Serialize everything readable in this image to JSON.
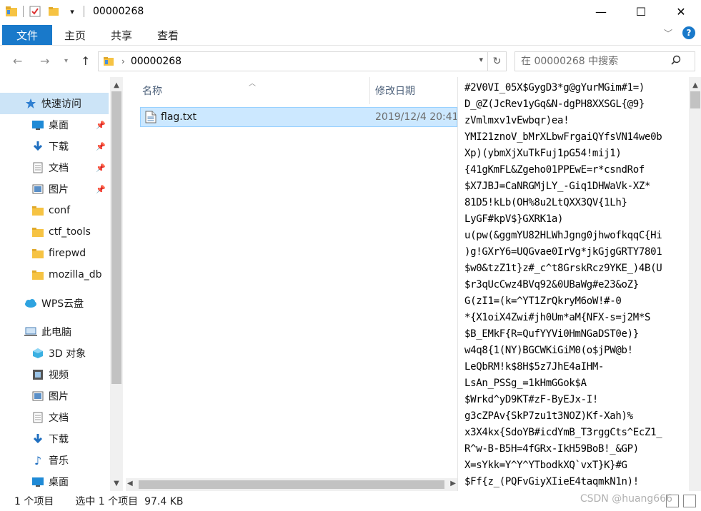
{
  "window": {
    "title": "00000268",
    "controls": {
      "minimize": "—",
      "maximize": "☐",
      "close": "✕"
    }
  },
  "ribbon": {
    "tabs": [
      "文件",
      "主页",
      "共享",
      "查看"
    ]
  },
  "address": {
    "path": "00000268",
    "search_placeholder": "在 00000268 中搜索"
  },
  "nav": {
    "quick_access": "快速访问",
    "items": [
      {
        "label": "桌面",
        "icon": "desktop-icon",
        "pinned": true
      },
      {
        "label": "下载",
        "icon": "download-icon",
        "pinned": true
      },
      {
        "label": "文档",
        "icon": "document-icon",
        "pinned": true
      },
      {
        "label": "图片",
        "icon": "picture-icon",
        "pinned": true
      },
      {
        "label": "conf",
        "icon": "folder-icon",
        "pinned": false
      },
      {
        "label": "ctf_tools",
        "icon": "folder-icon",
        "pinned": false
      },
      {
        "label": "firepwd",
        "icon": "folder-icon",
        "pinned": false
      },
      {
        "label": "mozilla_db",
        "icon": "folder-icon",
        "pinned": false
      }
    ],
    "wps": "WPS云盘",
    "this_pc": "此电脑",
    "pc_items": [
      {
        "label": "3D 对象",
        "icon": "3d-objects-icon"
      },
      {
        "label": "视频",
        "icon": "video-icon"
      },
      {
        "label": "图片",
        "icon": "picture-icon"
      },
      {
        "label": "文档",
        "icon": "document-icon"
      },
      {
        "label": "下载",
        "icon": "download-icon"
      },
      {
        "label": "音乐",
        "icon": "music-icon"
      },
      {
        "label": "桌面",
        "icon": "desktop-icon"
      }
    ]
  },
  "filelist": {
    "col_name": "名称",
    "col_date": "修改日期",
    "files": [
      {
        "name": "flag.txt",
        "date": "2019/12/4 20:41"
      }
    ]
  },
  "preview": {
    "lines": [
      "#2V0VI_05X$GygD3*g@gYurMGim#1=)",
      "D_@Z(JcRev1yGq&N-dgPH8XXSGL{@9}",
      "zVmlmxv1vEwbqr)ea!",
      "YMI21znoV_bMrXLbwFrgaiQYfsVN14we0b",
      "Xp)(ybmXjXuTkFuj1pG54!mij1)",
      "{41gKmFL&Zgeho01PPEwE=r*csndRof",
      "$X7JBJ=CaNRGMjLY_-Giq1DHWaVk-XZ*",
      "81D5!kLb(OH%8u2LtQXX3QV{1Lh}",
      "LyGF#kpV$}GXRK1a)",
      "u(pw(&ggmYU82HLWhJgng0jhwofkqqC{Hi",
      ")g!GXrY6=UQGvae0IrVg*jkGjgGRTY7801",
      "$w0&tzZ1t}z#_c^t8GrskRcz9YKE_)4B(U",
      "$r3qUcCwz4BVq92&0UBaWg#e23&oZ}",
      "G(zI1=(k=^YT1ZrQkryM6oW!#-0",
      "*{X1oiX4Zwi#jh0Um*aM{NFX-s=j2M*S",
      "$B_EMkF{R=QufYYVi0HmNGaDST0e)}",
      "w4q8{1(NY)BGCWKiGiM0(o$jPW@b!",
      "LeQbRM!k$8H$5z7JhE4aIHM-",
      "LsAn_PSSg_=1kHmGGok$A",
      "$Wrkd^yD9KT#zF-ByEJx-I!",
      "g3cZPAv{SkP7zu1t3NOZ)Kf-Xah)%",
      "x3X4kx{SdoYB#icdYmB_T3rggCts^EcZ1_",
      "R^w-B-B5H=4fGRx-IkH59BoB!_&GP)",
      "X=sYkk=Y^Y^YTbodkXQ`vxT}K}#G",
      "$Ff{z_(PQFvGiyXIieE4taqmkN1n)!"
    ]
  },
  "status": {
    "count": "1 个项目",
    "selected": "选中 1 个项目  97.4 KB"
  },
  "watermark": "CSDN @huang666"
}
